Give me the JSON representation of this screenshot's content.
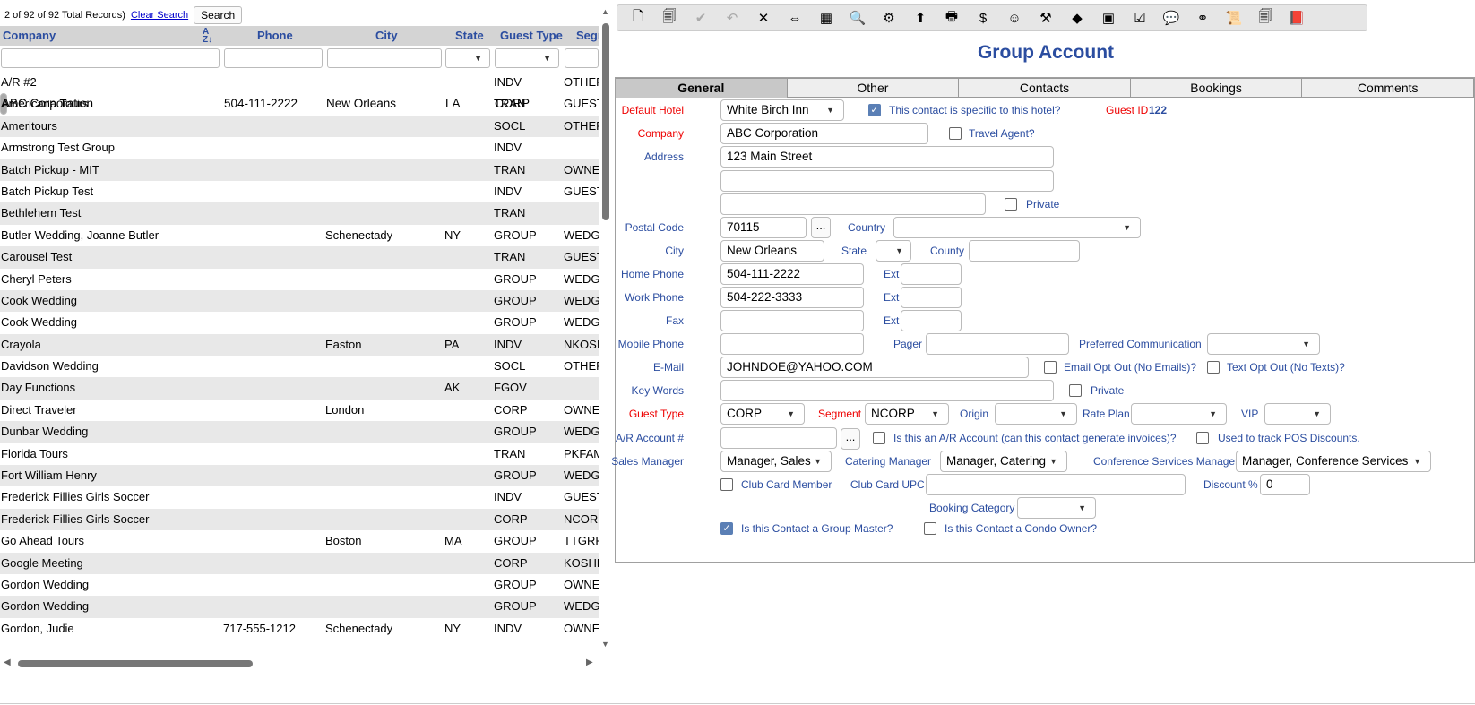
{
  "list": {
    "record_count": "2 of 92 of 92 Total Records)",
    "clear_search": "Clear Search",
    "search_btn": "Search",
    "columns": {
      "company": "Company",
      "phone": "Phone",
      "city": "City",
      "state": "State",
      "guest_type": "Guest Type",
      "segment": "Segm"
    },
    "rows": [
      {
        "company": "A/R #2",
        "phone": "",
        "city": "",
        "state": "",
        "type": "INDV",
        "seg": "OTHER"
      },
      {
        "company": "ABC Corporation",
        "phone": "504-111-2222",
        "city": "New Orleans",
        "state": "LA",
        "type": "CORP",
        "seg": "",
        "selected": true
      },
      {
        "company": "Americana Tours",
        "phone": "",
        "city": "",
        "state": "",
        "type": "TRAN",
        "seg": "GUEST"
      },
      {
        "company": "Ameritours",
        "phone": "",
        "city": "",
        "state": "",
        "type": "SOCL",
        "seg": "OTHER"
      },
      {
        "company": "Armstrong Test Group",
        "phone": "",
        "city": "",
        "state": "",
        "type": "INDV",
        "seg": ""
      },
      {
        "company": "Batch Pickup - MIT",
        "phone": "",
        "city": "",
        "state": "",
        "type": "TRAN",
        "seg": "OWNE"
      },
      {
        "company": "Batch Pickup Test",
        "phone": "",
        "city": "",
        "state": "",
        "type": "INDV",
        "seg": "GUEST"
      },
      {
        "company": "Bethlehem Test",
        "phone": "",
        "city": "",
        "state": "",
        "type": "TRAN",
        "seg": ""
      },
      {
        "company": "Butler Wedding, Joanne Butler",
        "phone": "",
        "city": "Schenectady",
        "state": "NY",
        "type": "GROUP",
        "seg": "WEDG"
      },
      {
        "company": "Carousel Test",
        "phone": "",
        "city": "",
        "state": "",
        "type": "TRAN",
        "seg": "GUEST"
      },
      {
        "company": "Cheryl Peters",
        "phone": "",
        "city": "",
        "state": "",
        "type": "GROUP",
        "seg": "WEDG"
      },
      {
        "company": "Cook Wedding",
        "phone": "",
        "city": "",
        "state": "",
        "type": "GROUP",
        "seg": "WEDG"
      },
      {
        "company": "Cook Wedding",
        "phone": "",
        "city": "",
        "state": "",
        "type": "GROUP",
        "seg": "WEDG"
      },
      {
        "company": "Crayola",
        "phone": "",
        "city": "Easton",
        "state": "PA",
        "type": "INDV",
        "seg": "NKOSI"
      },
      {
        "company": "Davidson Wedding",
        "phone": "",
        "city": "",
        "state": "",
        "type": "SOCL",
        "seg": "OTHER"
      },
      {
        "company": "Day Functions",
        "phone": "",
        "city": "",
        "state": "AK",
        "type": "FGOV",
        "seg": ""
      },
      {
        "company": "Direct Traveler",
        "phone": "",
        "city": "London",
        "state": "",
        "type": "CORP",
        "seg": "OWNE"
      },
      {
        "company": "Dunbar Wedding",
        "phone": "",
        "city": "",
        "state": "",
        "type": "GROUP",
        "seg": "WEDG"
      },
      {
        "company": "Florida Tours",
        "phone": "",
        "city": "",
        "state": "",
        "type": "TRAN",
        "seg": "PKFAM"
      },
      {
        "company": "Fort William Henry",
        "phone": "",
        "city": "",
        "state": "",
        "type": "GROUP",
        "seg": "WEDG"
      },
      {
        "company": "Frederick Fillies Girls Soccer",
        "phone": "",
        "city": "",
        "state": "",
        "type": "INDV",
        "seg": "GUEST"
      },
      {
        "company": "Frederick Fillies Girls Soccer",
        "phone": "",
        "city": "",
        "state": "",
        "type": "CORP",
        "seg": "NCOR"
      },
      {
        "company": "Go Ahead Tours",
        "phone": "",
        "city": "Boston",
        "state": "MA",
        "type": "GROUP",
        "seg": "TTGRP"
      },
      {
        "company": "Google Meeting",
        "phone": "",
        "city": "",
        "state": "",
        "type": "CORP",
        "seg": "KOSHE"
      },
      {
        "company": "Gordon Wedding",
        "phone": "",
        "city": "",
        "state": "",
        "type": "GROUP",
        "seg": "OWNE"
      },
      {
        "company": "Gordon Wedding",
        "phone": "",
        "city": "",
        "state": "",
        "type": "GROUP",
        "seg": "WEDG"
      },
      {
        "company": "Gordon, Judie",
        "phone": "717-555-1212",
        "city": "Schenectady",
        "state": "NY",
        "type": "INDV",
        "seg": "OWNE"
      }
    ]
  },
  "toolbar": {
    "icons": [
      "new-doc-icon",
      "copy-doc-icon",
      "check-icon",
      "undo-icon",
      "delete-icon",
      "merge-icon",
      "calculator-icon",
      "find-icon",
      "network-icon",
      "export-icon",
      "print-icon",
      "money-icon",
      "smiley-icon",
      "tools-icon",
      "eraser-icon",
      "stamp-icon",
      "clipboard-icon",
      "chat-icon",
      "glasses-icon",
      "scroll-icon",
      "documents-icon",
      "book-icon"
    ],
    "glyphs": [
      "🗋",
      "🗐",
      "✔",
      "↶",
      "✕",
      "⇔",
      "▦",
      "🔍",
      "⚙",
      "⬆",
      "🖶",
      "$",
      "☺",
      "⚒",
      "◆",
      "▣",
      "☑",
      "💬",
      "⚭",
      "📜",
      "🗐",
      "📕"
    ]
  },
  "form": {
    "title": "Group Account",
    "tabs": [
      "General",
      "Other",
      "Contacts",
      "Bookings",
      "Comments"
    ],
    "labels": {
      "default_hotel": "Default Hotel",
      "specific_hotel": "This contact is specific to this hotel?",
      "guest_id": "Guest ID",
      "company": "Company",
      "travel_agent": "Travel Agent?",
      "address": "Address",
      "private": "Private",
      "postal_code": "Postal Code",
      "country": "Country",
      "city": "City",
      "state": "State",
      "county": "County",
      "home_phone": "Home Phone",
      "ext": "Ext",
      "work_phone": "Work Phone",
      "fax": "Fax",
      "mobile_phone": "Mobile Phone",
      "pager": "Pager",
      "pref_comm": "Preferred Communication",
      "email": "E-Mail",
      "email_opt_out": "Email Opt Out (No Emails)?",
      "text_opt_out": "Text Opt Out (No Texts)?",
      "key_words": "Key Words",
      "guest_type": "Guest Type",
      "segment": "Segment",
      "origin": "Origin",
      "rate_plan": "Rate Plan",
      "vip": "VIP",
      "ar_account": "A/R Account #",
      "is_ar": "Is this an A/R Account (can this contact generate invoices)?",
      "pos_discounts": "Used to track POS Discounts.",
      "sales_manager": "Sales Manager",
      "catering_manager": "Catering Manager",
      "conf_manager": "Conference Services Manager",
      "club_card_member": "Club Card Member",
      "club_card_upc": "Club Card UPC",
      "discount": "Discount %",
      "booking_category": "Booking Category",
      "group_master": "Is this Contact a Group Master?",
      "condo_owner": "Is this Contact a Condo Owner?"
    },
    "values": {
      "default_hotel": "White Birch Inn",
      "guest_id": "122",
      "company": "ABC Corporation",
      "address1": "123 Main Street",
      "address2": "",
      "address3": "",
      "postal_code": "70115",
      "country": "",
      "city": "New Orleans",
      "state": "",
      "county": "",
      "home_phone": "504-111-2222",
      "home_ext": "",
      "work_phone": "504-222-3333",
      "work_ext": "",
      "fax": "",
      "fax_ext": "",
      "mobile_phone": "",
      "pager": "",
      "pref_comm": "",
      "email": "JOHNDOE@YAHOO.COM",
      "key_words": "",
      "guest_type": "CORP",
      "segment": "NCORP",
      "origin": "",
      "rate_plan": "",
      "vip": "",
      "ar_account": "",
      "sales_manager": "Manager, Sales",
      "catering_manager": "Manager, Catering",
      "conf_manager": "Manager, Conference Services",
      "club_card_upc": "",
      "discount": "0",
      "booking_category": "",
      "dots": "..."
    },
    "checks": {
      "specific_hotel": true,
      "travel_agent": false,
      "address_private": false,
      "email_opt_out": false,
      "text_opt_out": false,
      "keywords_private": false,
      "is_ar": false,
      "pos_discounts": false,
      "club_card_member": false,
      "group_master": true,
      "condo_owner": false
    }
  }
}
